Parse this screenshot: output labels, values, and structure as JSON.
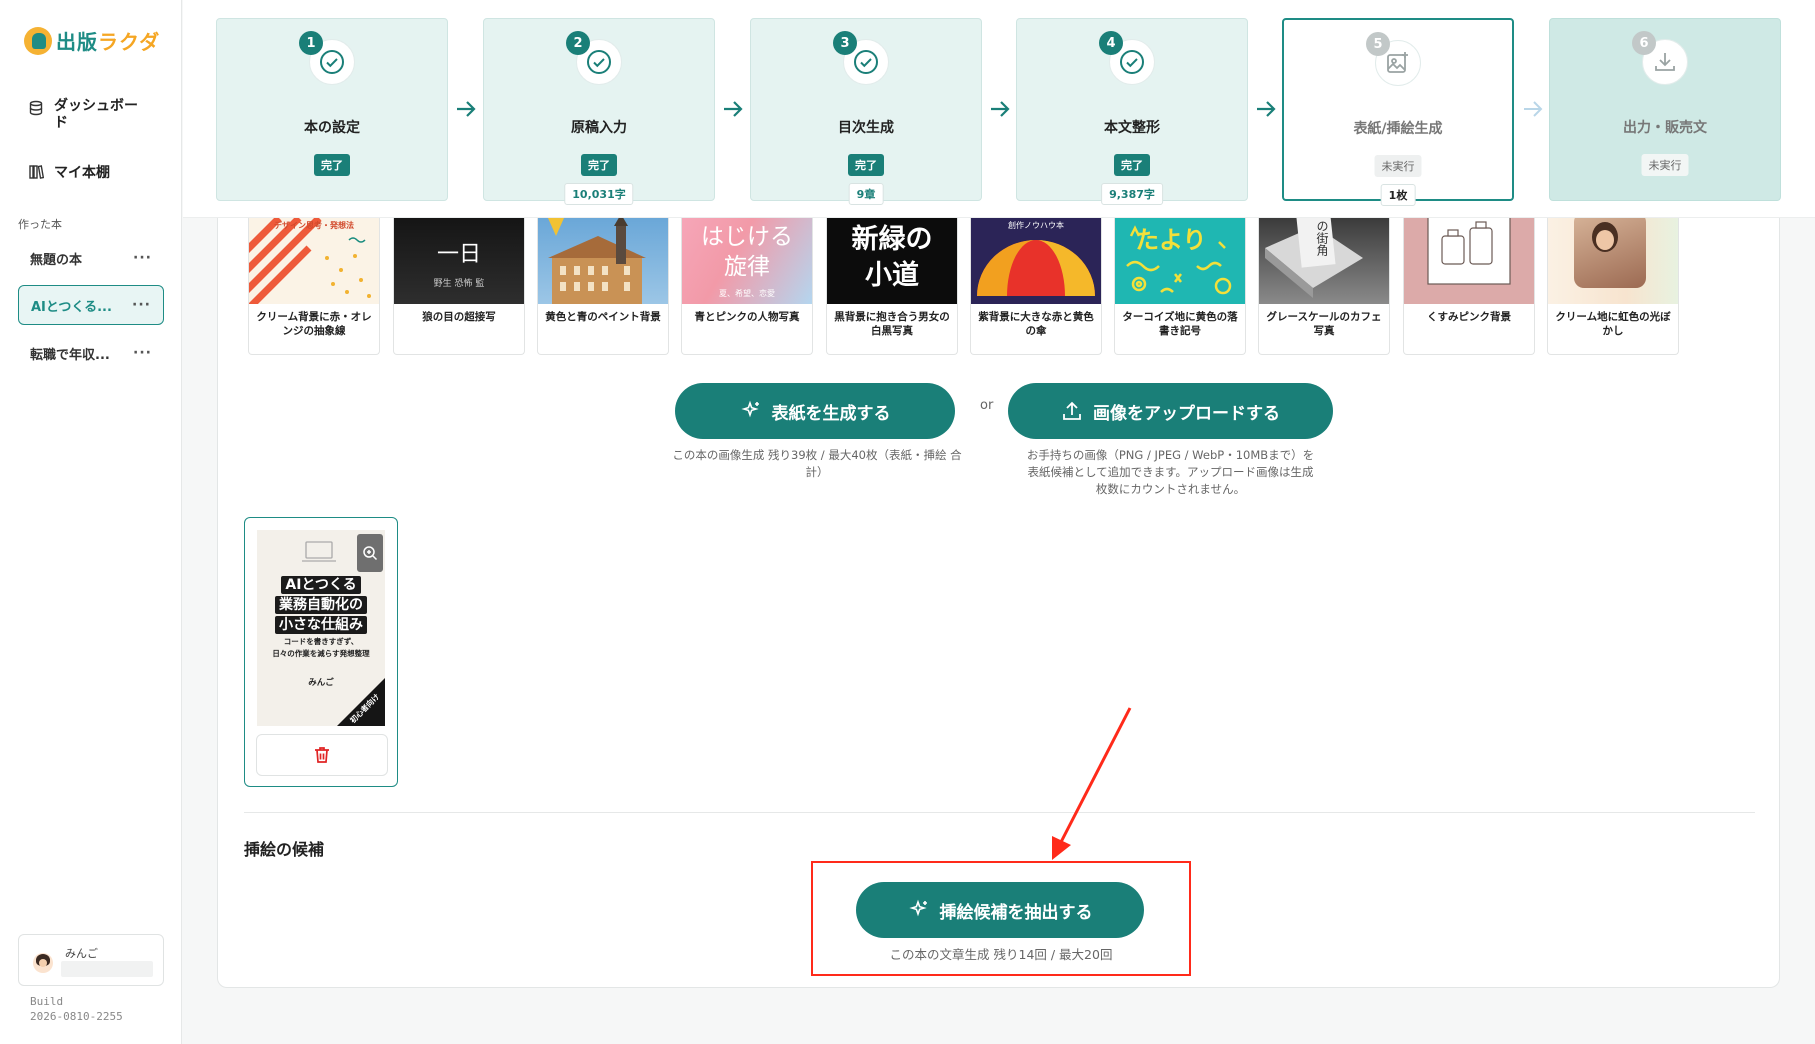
{
  "app": {
    "logo_text_1": "出版",
    "logo_text_2": "ラクダ"
  },
  "sidebar": {
    "nav": [
      {
        "label": "ダッシュボード",
        "icon": "database-icon"
      },
      {
        "label": "マイ本棚",
        "icon": "books-icon"
      }
    ],
    "section_label": "作った本",
    "books": [
      {
        "title": "無題の本",
        "more": "···",
        "active": false
      },
      {
        "title": "AIとつくる...",
        "more": "···",
        "active": true
      },
      {
        "title": "転職で年収...",
        "more": "···",
        "active": false
      }
    ],
    "user": {
      "name": "みんご"
    },
    "build_label": "Build",
    "build_id": "2026-0810-2255"
  },
  "stepper": {
    "steps": [
      {
        "num": "1",
        "title": "本の設定",
        "status": "完了",
        "count": "",
        "state": "done"
      },
      {
        "num": "2",
        "title": "原稿入力",
        "status": "完了",
        "count": "10,031字",
        "state": "done"
      },
      {
        "num": "3",
        "title": "目次生成",
        "status": "完了",
        "count": "9章",
        "state": "done"
      },
      {
        "num": "4",
        "title": "本文整形",
        "status": "完了",
        "count": "9,387字",
        "state": "done"
      },
      {
        "num": "5",
        "title": "表紙/挿絵生成",
        "status": "未実行",
        "count": "1枚",
        "state": "current"
      },
      {
        "num": "6",
        "title": "出力・販売文",
        "status": "未実行",
        "count": "",
        "state": "pending"
      }
    ]
  },
  "templates": [
    {
      "caption": "クリーム背景に赤・オレンジの抽象線",
      "art_text": "デザイン思考・発想法"
    },
    {
      "caption": "狼の目の超接写",
      "art_text": "一日",
      "art_sub": "野生 恐怖 監"
    },
    {
      "caption": "黄色と青のペイント背景",
      "art_text": ""
    },
    {
      "caption": "青とピンクの人物写真",
      "art_text": "はじける旋律",
      "art_sub": "夏、希望、恋愛"
    },
    {
      "caption": "黒背景に抱き合う男女の白黒写真",
      "art_text": "新緑の小道"
    },
    {
      "caption": "紫背景に大きな赤と黄色の傘",
      "art_text": "創作ノウハウ本"
    },
    {
      "caption": "ターコイズ地に黄色の落書き記号",
      "art_text": "たより"
    },
    {
      "caption": "グレースケールのカフェ写真",
      "art_text": "の街角"
    },
    {
      "caption": "くすみピンク背景",
      "art_text": ""
    },
    {
      "caption": "クリーム地に虹色の光ぼかし",
      "art_text": ""
    }
  ],
  "actions": {
    "generate_cover": "表紙を生成する",
    "or": "or",
    "upload_image": "画像をアップロードする",
    "generate_note": "この本の画像生成 残り39枚 / 最大40枚（表紙・挿絵 合計）",
    "upload_note_1": "お手持ちの画像（PNG / JPEG / WebP・10MBまで）を",
    "upload_note_2": "表紙候補として追加できます。アップロード画像は生成",
    "upload_note_3": "枚数にカウントされません。"
  },
  "cover": {
    "line1": "AIとつくる",
    "line2": "業務自動化の",
    "line3": "小さな仕組み",
    "sub1": "コードを書きすぎず、",
    "sub2": "日々の作業を減らす発想整理",
    "author": "みんご",
    "ribbon": "初心者向け"
  },
  "illustration": {
    "section_title": "挿絵の候補",
    "extract_button": "挿絵候補を抽出する",
    "quota_note": "この本の文章生成 残り14回 / 最大20回"
  },
  "colors": {
    "accent": "#1a7f78",
    "highlight": "#ff2a1a"
  }
}
